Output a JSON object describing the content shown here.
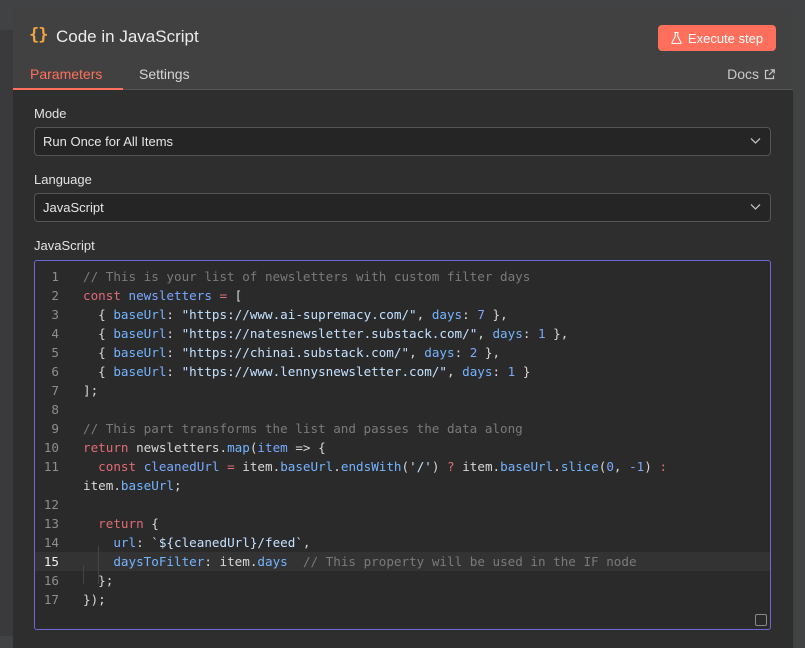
{
  "header": {
    "icon": "curly-braces-icon",
    "icon_glyph": "{}",
    "title": "Code in JavaScript",
    "execute_label": "Execute step",
    "accent_color": "#ff6f5c"
  },
  "tabs": [
    {
      "label": "Parameters",
      "active": true
    },
    {
      "label": "Settings",
      "active": false
    }
  ],
  "docs_label": "Docs",
  "fields": {
    "mode": {
      "label": "Mode",
      "value": "Run Once for All Items"
    },
    "language": {
      "label": "Language",
      "value": "JavaScript"
    },
    "code": {
      "label": "JavaScript"
    }
  },
  "editor": {
    "active_line": 15,
    "line_numbers": [
      "1",
      "2",
      "3",
      "4",
      "5",
      "6",
      "7",
      "8",
      "9",
      "10",
      "11",
      "",
      "12",
      "13",
      "14",
      "15",
      "16",
      "17"
    ],
    "lines": [
      [
        {
          "t": "// This is your list of newsletters with custom filter days",
          "c": "com"
        }
      ],
      [
        {
          "t": "const",
          "c": "kw"
        },
        {
          "t": " ",
          "c": "plain"
        },
        {
          "t": "newsletters",
          "c": "def"
        },
        {
          "t": " = ",
          "c": "kw"
        },
        {
          "t": "[",
          "c": "plain"
        }
      ],
      [
        {
          "t": "  { ",
          "c": "plain"
        },
        {
          "t": "baseUrl",
          "c": "prop"
        },
        {
          "t": ": ",
          "c": "plain"
        },
        {
          "t": "\"https://www.ai-supremacy.com/\"",
          "c": "str"
        },
        {
          "t": ", ",
          "c": "plain"
        },
        {
          "t": "days",
          "c": "prop"
        },
        {
          "t": ": ",
          "c": "plain"
        },
        {
          "t": "7",
          "c": "num"
        },
        {
          "t": " },",
          "c": "plain"
        }
      ],
      [
        {
          "t": "  { ",
          "c": "plain"
        },
        {
          "t": "baseUrl",
          "c": "prop"
        },
        {
          "t": ": ",
          "c": "plain"
        },
        {
          "t": "\"https://natesnewsletter.substack.com/\"",
          "c": "str"
        },
        {
          "t": ", ",
          "c": "plain"
        },
        {
          "t": "days",
          "c": "prop"
        },
        {
          "t": ": ",
          "c": "plain"
        },
        {
          "t": "1",
          "c": "num"
        },
        {
          "t": " },",
          "c": "plain"
        }
      ],
      [
        {
          "t": "  { ",
          "c": "plain"
        },
        {
          "t": "baseUrl",
          "c": "prop"
        },
        {
          "t": ": ",
          "c": "plain"
        },
        {
          "t": "\"https://chinai.substack.com/\"",
          "c": "str"
        },
        {
          "t": ", ",
          "c": "plain"
        },
        {
          "t": "days",
          "c": "prop"
        },
        {
          "t": ": ",
          "c": "plain"
        },
        {
          "t": "2",
          "c": "num"
        },
        {
          "t": " },",
          "c": "plain"
        }
      ],
      [
        {
          "t": "  { ",
          "c": "plain"
        },
        {
          "t": "baseUrl",
          "c": "prop"
        },
        {
          "t": ": ",
          "c": "plain"
        },
        {
          "t": "\"https://www.lennysnewsletter.com/\"",
          "c": "str"
        },
        {
          "t": ", ",
          "c": "plain"
        },
        {
          "t": "days",
          "c": "prop"
        },
        {
          "t": ": ",
          "c": "plain"
        },
        {
          "t": "1",
          "c": "num"
        },
        {
          "t": " }",
          "c": "plain"
        }
      ],
      [
        {
          "t": "];",
          "c": "plain"
        }
      ],
      [],
      [
        {
          "t": "// This part transforms the list and passes the data along",
          "c": "com"
        }
      ],
      [
        {
          "t": "return",
          "c": "kw"
        },
        {
          "t": " newsletters.",
          "c": "plain"
        },
        {
          "t": "map",
          "c": "prop"
        },
        {
          "t": "(",
          "c": "plain"
        },
        {
          "t": "item",
          "c": "def"
        },
        {
          "t": " => {",
          "c": "plain"
        }
      ],
      [
        {
          "t": "  ",
          "c": "plain"
        },
        {
          "t": "const",
          "c": "kw"
        },
        {
          "t": " ",
          "c": "plain"
        },
        {
          "t": "cleanedUrl",
          "c": "def"
        },
        {
          "t": " = ",
          "c": "kw"
        },
        {
          "t": "item.",
          "c": "plain"
        },
        {
          "t": "baseUrl",
          "c": "prop"
        },
        {
          "t": ".",
          "c": "plain"
        },
        {
          "t": "endsWith",
          "c": "prop"
        },
        {
          "t": "(",
          "c": "plain"
        },
        {
          "t": "'/'",
          "c": "str"
        },
        {
          "t": ") ",
          "c": "plain"
        },
        {
          "t": "?",
          "c": "kw"
        },
        {
          "t": " item.",
          "c": "plain"
        },
        {
          "t": "baseUrl",
          "c": "prop"
        },
        {
          "t": ".",
          "c": "plain"
        },
        {
          "t": "slice",
          "c": "prop"
        },
        {
          "t": "(",
          "c": "plain"
        },
        {
          "t": "0",
          "c": "num"
        },
        {
          "t": ", ",
          "c": "plain"
        },
        {
          "t": "-1",
          "c": "num"
        },
        {
          "t": ") ",
          "c": "plain"
        },
        {
          "t": ":",
          "c": "kw"
        }
      ],
      [
        {
          "t": "item.",
          "c": "plain"
        },
        {
          "t": "baseUrl",
          "c": "prop"
        },
        {
          "t": ";",
          "c": "plain"
        }
      ],
      [],
      [
        {
          "t": "  ",
          "c": "plain"
        },
        {
          "t": "return",
          "c": "kw"
        },
        {
          "t": " {",
          "c": "plain"
        }
      ],
      [
        {
          "t": "    ",
          "c": "plain"
        },
        {
          "t": "url",
          "c": "prop"
        },
        {
          "t": ": ",
          "c": "plain"
        },
        {
          "t": "`${cleanedUrl}/feed`",
          "c": "str"
        },
        {
          "t": ",",
          "c": "plain"
        }
      ],
      [
        {
          "t": "    ",
          "c": "plain"
        },
        {
          "t": "daysToFilter",
          "c": "prop"
        },
        {
          "t": ": item.",
          "c": "plain"
        },
        {
          "t": "days",
          "c": "prop"
        },
        {
          "t": "  ",
          "c": "plain"
        },
        {
          "t": "// This property will be used in the IF node",
          "c": "com"
        }
      ],
      [
        {
          "t": "  };",
          "c": "plain"
        }
      ],
      [
        {
          "t": "});",
          "c": "plain"
        }
      ]
    ],
    "colors": {
      "com": "#7a7a7a",
      "kw": "#e06c75",
      "def": "#79a9ff",
      "prop": "#74b4ff",
      "str": "#c4e1ff",
      "num": "#7ea6ff",
      "plain": "#d8d8d8"
    }
  }
}
